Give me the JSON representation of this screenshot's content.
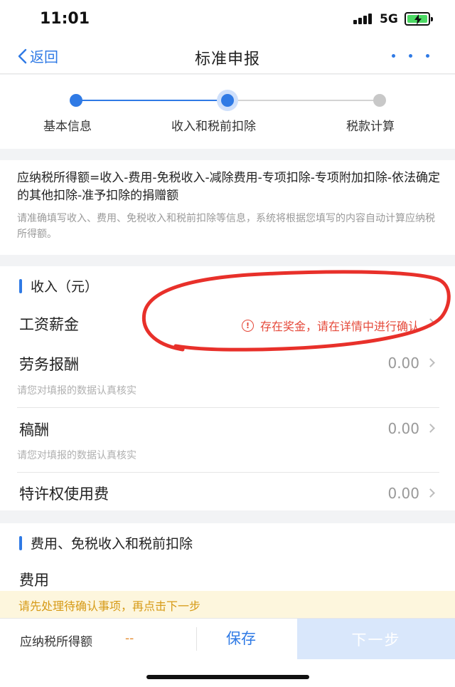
{
  "status_bar": {
    "time": "11:01",
    "network": "5G"
  },
  "nav": {
    "back_label": "返回",
    "title": "标准申报"
  },
  "steps": [
    {
      "label": "基本信息",
      "state": "done"
    },
    {
      "label": "收入和税前扣除",
      "state": "current"
    },
    {
      "label": "税款计算",
      "state": "pending"
    }
  ],
  "formula": {
    "main": "应纳税所得额=收入-费用-免税收入-减除费用-专项扣除-专项附加扣除-依法确定的其他扣除-准予扣除的捐赠额",
    "note": "请准确填写收入、费用、免税收入和税前扣除等信息，系统将根据您填写的内容自动计算应纳税所得额。"
  },
  "income": {
    "title": "收入（元）",
    "rows": [
      {
        "label": "工资薪金",
        "warning": "存在奖金，请在详情中进行确认"
      },
      {
        "label": "劳务报酬",
        "value": "0.00",
        "hint": "请您对填报的数据认真核实"
      },
      {
        "label": "稿酬",
        "value": "0.00",
        "hint": "请您对填报的数据认真核实"
      },
      {
        "label": "特许权使用费",
        "value": "0.00"
      }
    ]
  },
  "expense": {
    "title": "费用、免税收入和税前扣除",
    "first_row": "费用"
  },
  "notice": "请先处理待确认事项，再点击下一步",
  "bottom": {
    "taxable_label": "应纳税所得额",
    "taxable_value": "--",
    "save_label": "保存",
    "next_label": "下一步"
  },
  "colors": {
    "accent": "#2f7ae5",
    "warning": "#e5493a",
    "notice": "#d69a16"
  }
}
